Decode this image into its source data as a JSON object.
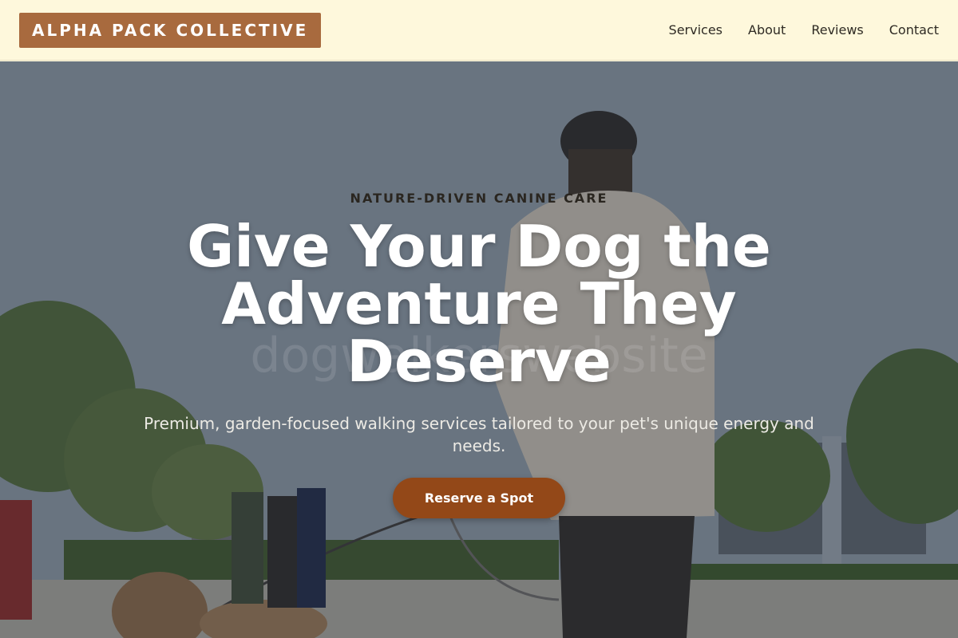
{
  "header": {
    "logo": "ALPHA PACK COLLECTIVE",
    "nav": [
      "Services",
      "About",
      "Reviews",
      "Contact"
    ]
  },
  "hero": {
    "eyebrow": "NATURE-DRIVEN CANINE CARE",
    "headline": "Give Your Dog the Adventure They Deserve",
    "subtext": "Premium, garden-focused walking services tailored to your pet's unique energy and needs.",
    "cta": "Reserve a Spot",
    "watermark": "dogwalkerswebsite"
  },
  "colors": {
    "header_bg": "#fef8dc",
    "logo_bg": "#a86a3e",
    "cta_bg": "#934818",
    "headline": "#ffffff"
  }
}
